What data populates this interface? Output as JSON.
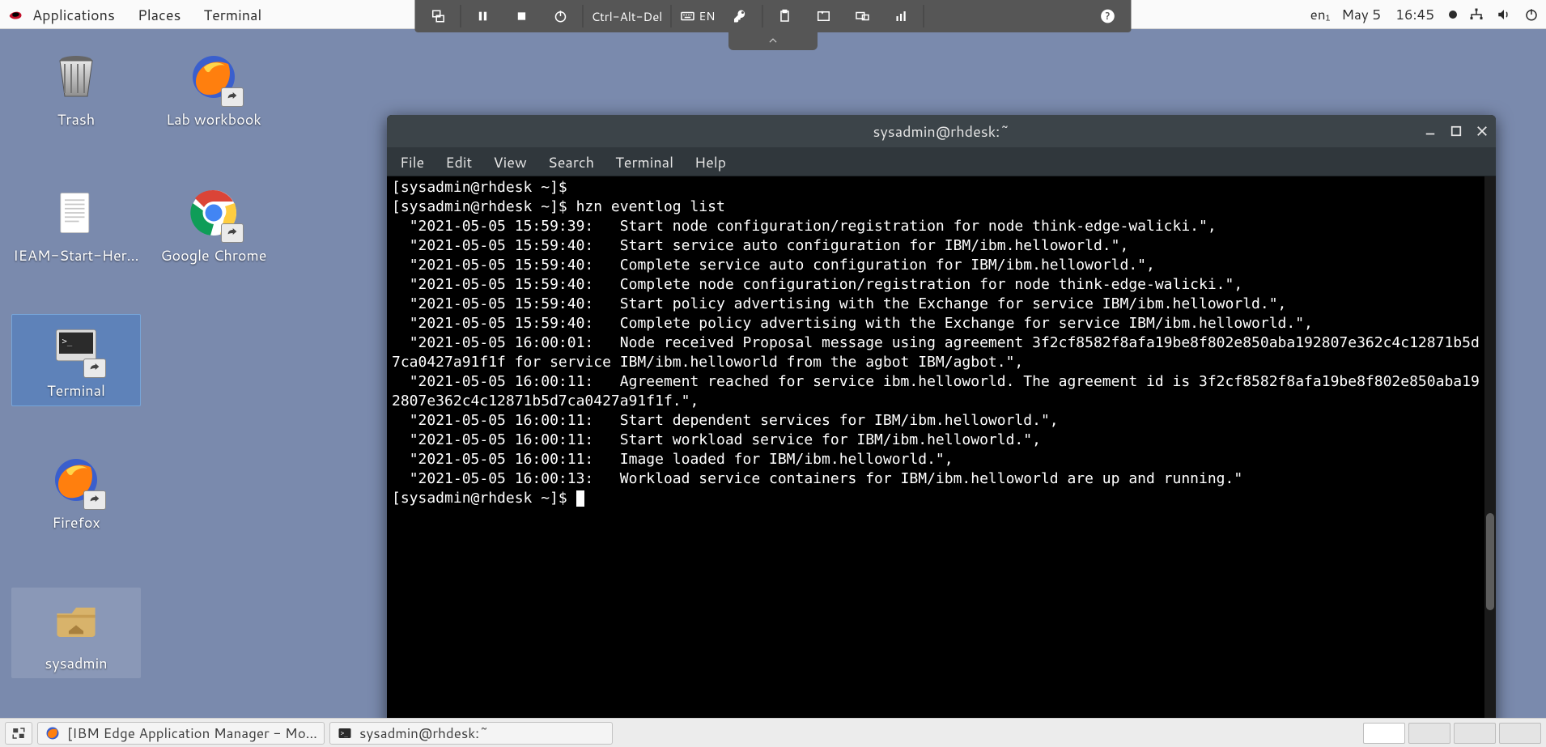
{
  "topbar": {
    "applications": "Applications",
    "places": "Places",
    "terminal": "Terminal",
    "input_label": "en₁",
    "date": "May 5",
    "time": "16:45"
  },
  "kvm": {
    "ctrl_alt_del": "Ctrl-Alt-Del",
    "lang": "EN"
  },
  "desktop_icons": {
    "trash": "Trash",
    "lab": "Lab workbook",
    "ieam": "IEAM-Start-Her…",
    "chrome": "Google Chrome",
    "terminal": "Terminal",
    "firefox": "Firefox",
    "home": "sysadmin"
  },
  "terminal": {
    "title": "sysadmin@rhdesk:~",
    "menu": {
      "file": "File",
      "edit": "Edit",
      "view": "View",
      "search": "Search",
      "terminal": "Terminal",
      "help": "Help"
    },
    "prompt": "[sysadmin@rhdesk ~]$",
    "command": "hzn eventlog list",
    "events": [
      "  \"2021-05-05 15:59:39:   Start node configuration/registration for node think-edge-walicki.\",",
      "  \"2021-05-05 15:59:40:   Start service auto configuration for IBM/ibm.helloworld.\",",
      "  \"2021-05-05 15:59:40:   Complete service auto configuration for IBM/ibm.helloworld.\",",
      "  \"2021-05-05 15:59:40:   Complete node configuration/registration for node think-edge-walicki.\",",
      "  \"2021-05-05 15:59:40:   Start policy advertising with the Exchange for service IBM/ibm.helloworld.\",",
      "  \"2021-05-05 15:59:40:   Complete policy advertising with the Exchange for service IBM/ibm.helloworld.\",",
      "  \"2021-05-05 16:00:01:   Node received Proposal message using agreement 3f2cf8582f8afa19be8f802e850aba192807e362c4c12871b5d7ca0427a91f1f for service IBM/ibm.helloworld from the agbot IBM/agbot.\",",
      "  \"2021-05-05 16:00:11:   Agreement reached for service ibm.helloworld. The agreement id is 3f2cf8582f8afa19be8f802e850aba192807e362c4c12871b5d7ca0427a91f1f.\",",
      "  \"2021-05-05 16:00:11:   Start dependent services for IBM/ibm.helloworld.\",",
      "  \"2021-05-05 16:00:11:   Start workload service for IBM/ibm.helloworld.\",",
      "  \"2021-05-05 16:00:11:   Image loaded for IBM/ibm.helloworld.\",",
      "  \"2021-05-05 16:00:13:   Workload service containers for IBM/ibm.helloworld are up and running.\""
    ]
  },
  "bottombar": {
    "task1": "[IBM Edge Application Manager - Mo…",
    "task2": "sysadmin@rhdesk:~"
  }
}
